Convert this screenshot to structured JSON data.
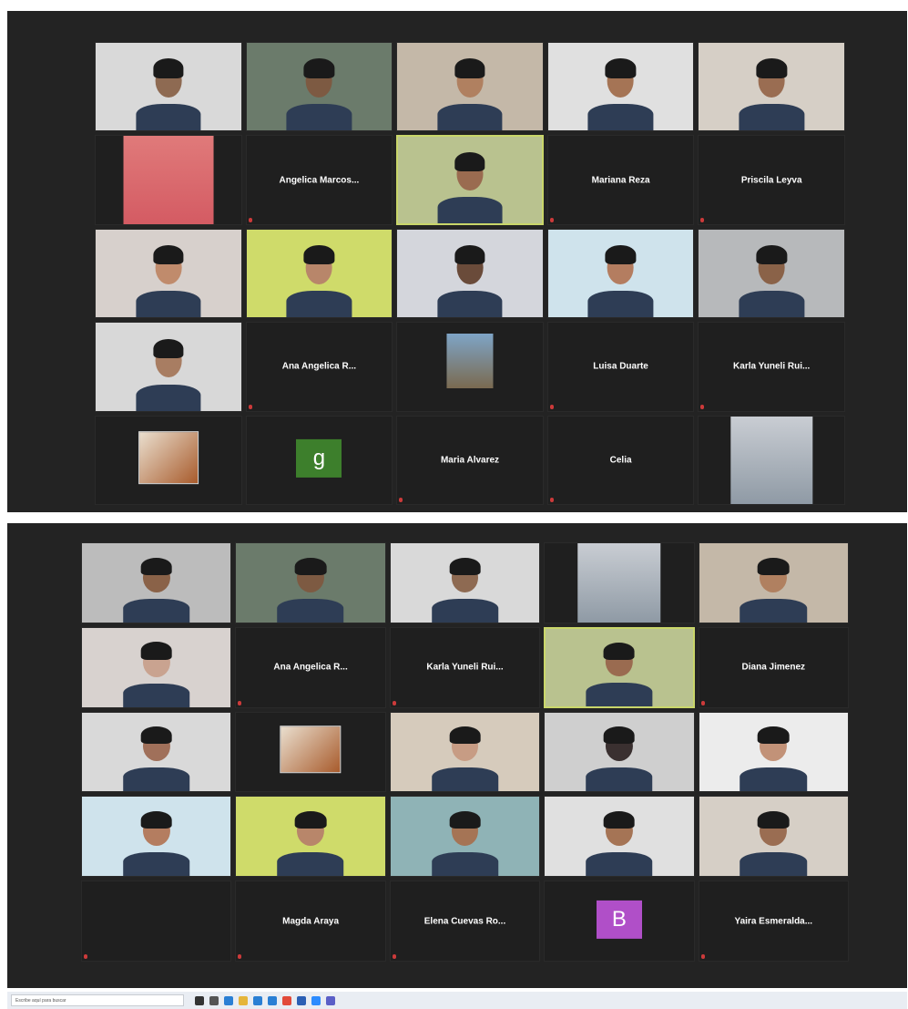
{
  "screenshot_top": {
    "tiles": [
      {
        "kind": "video",
        "label": "",
        "skin": "#8e6a52",
        "bg": "#d9d9d9"
      },
      {
        "kind": "video",
        "label": "",
        "skin": "#7d5a42",
        "bg": "#6b7b6b"
      },
      {
        "kind": "video",
        "label": "",
        "skin": "#b08060",
        "bg": "#c4b8a8"
      },
      {
        "kind": "video",
        "label": "",
        "skin": "#a57455",
        "bg": "#e0e0e0"
      },
      {
        "kind": "video",
        "label": "",
        "skin": "#9a6d52",
        "bg": "#d6cfc6"
      },
      {
        "kind": "photo-portrait",
        "label": ""
      },
      {
        "kind": "name",
        "name": "Angelica  Marcos..."
      },
      {
        "kind": "video",
        "label": "",
        "skin": "#9a6b50",
        "bg": "#b9c28f",
        "active": true
      },
      {
        "kind": "name",
        "name": "Mariana Reza"
      },
      {
        "kind": "name",
        "name": "Priscila Leyva"
      },
      {
        "kind": "video",
        "label": "",
        "skin": "#c08b6c",
        "bg": "#d7d0cc"
      },
      {
        "kind": "video",
        "label": "",
        "skin": "#b8866a",
        "bg": "#cfdb6a"
      },
      {
        "kind": "video",
        "label": "",
        "skin": "#6a4b3a",
        "bg": "#d4d6dc"
      },
      {
        "kind": "video",
        "label": "",
        "skin": "#b47d60",
        "bg": "#cfe3ec"
      },
      {
        "kind": "video",
        "label": "",
        "skin": "#8a6248",
        "bg": "#b7b9bb"
      },
      {
        "kind": "video",
        "label": "",
        "skin": "#a87d62",
        "bg": "#d8d8d8"
      },
      {
        "kind": "name",
        "name": "Ana Angelica  R..."
      },
      {
        "kind": "photo-small",
        "label": ""
      },
      {
        "kind": "name",
        "name": "Luisa Duarte"
      },
      {
        "kind": "name",
        "name": "Karla  Yuneli  Rui..."
      },
      {
        "kind": "image",
        "label": ""
      },
      {
        "kind": "letter",
        "letter": "g",
        "color": "#3d7f2c",
        "label": ""
      },
      {
        "kind": "name",
        "name": "Maria Alvarez"
      },
      {
        "kind": "name",
        "name": "Celia"
      },
      {
        "kind": "photo-field",
        "label": ""
      }
    ]
  },
  "screenshot_bottom": {
    "tiles": [
      {
        "kind": "video",
        "label": "",
        "skin": "#8a6248",
        "bg": "#bcbcbc"
      },
      {
        "kind": "video",
        "label": "",
        "skin": "#7d5a42",
        "bg": "#6b7b6b"
      },
      {
        "kind": "video",
        "label": "",
        "skin": "#8e6a52",
        "bg": "#d9d9d9"
      },
      {
        "kind": "photo-field",
        "label": ""
      },
      {
        "kind": "video",
        "label": "",
        "skin": "#b08060",
        "bg": "#c4b8a8"
      },
      {
        "kind": "video",
        "label": "",
        "skin": "#c9a390",
        "bg": "#d8d2cf"
      },
      {
        "kind": "name",
        "name": "Ana Angelica  R..."
      },
      {
        "kind": "name",
        "name": "Karla  Yuneli  Rui..."
      },
      {
        "kind": "video",
        "label": "",
        "skin": "#9a6b50",
        "bg": "#b9c28f",
        "active": true
      },
      {
        "kind": "name",
        "name": "Diana Jimenez"
      },
      {
        "kind": "video",
        "label": "",
        "skin": "#a0705a",
        "bg": "#d9d9d9"
      },
      {
        "kind": "image",
        "label": ""
      },
      {
        "kind": "video",
        "label": "",
        "skin": "#c79c84",
        "bg": "#d6cbbc"
      },
      {
        "kind": "video",
        "label": "",
        "skin": "#3a3030",
        "bg": "#cfcfcf"
      },
      {
        "kind": "video",
        "label": "",
        "skin": "#c29278",
        "bg": "#ececec"
      },
      {
        "kind": "video",
        "label": "",
        "skin": "#b47d60",
        "bg": "#cfe3ec"
      },
      {
        "kind": "video",
        "label": "",
        "skin": "#b8866a",
        "bg": "#cfdb6a"
      },
      {
        "kind": "video",
        "label": "",
        "skin": "#a57455",
        "bg": "#8fb3b6"
      },
      {
        "kind": "video",
        "label": "",
        "skin": "#a57455",
        "bg": "#e0e0e0"
      },
      {
        "kind": "video",
        "label": "",
        "skin": "#9a6d52",
        "bg": "#d6cfc6"
      },
      {
        "kind": "name",
        "name": ""
      },
      {
        "kind": "name",
        "name": "Magda Araya"
      },
      {
        "kind": "name",
        "name": "Elena Cuevas Ro..."
      },
      {
        "kind": "letter",
        "letter": "B",
        "color": "#b04fc8",
        "label": ""
      },
      {
        "kind": "name",
        "name": "Yaira Esmeralda..."
      }
    ]
  },
  "taskbar": {
    "search_placeholder": "Escribe aquí para buscar",
    "icons": [
      "start-icon",
      "task-view-icon",
      "edge-icon",
      "explorer-icon",
      "mail-icon",
      "store-icon",
      "chrome-icon",
      "word-icon",
      "zoom-icon",
      "teams-icon"
    ],
    "icon_colors": [
      "#333333",
      "#555555",
      "#2a7fd4",
      "#e5b53a",
      "#2a7fd4",
      "#2a7fd4",
      "#e24a3a",
      "#2b5fb4",
      "#2d8cff",
      "#5b5fc7"
    ]
  }
}
